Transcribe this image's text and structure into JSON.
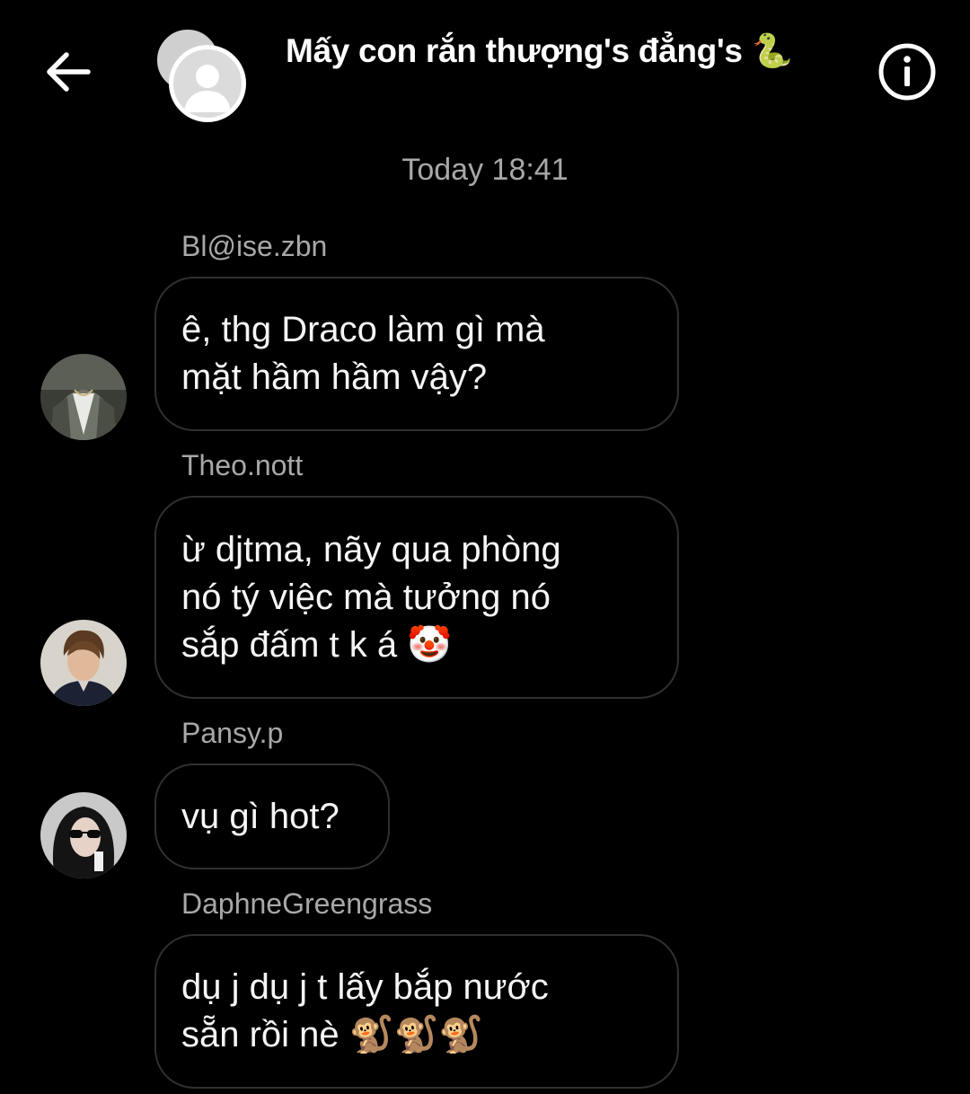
{
  "header": {
    "back_icon": "arrow-left-icon",
    "title": "Mấy con rắn thượng's đẳng's 🐍",
    "info_icon": "info-circle-icon"
  },
  "chat": {
    "timestamp": "Today 18:41",
    "messages": [
      {
        "sender": "Bl@ise.zbn",
        "lines": [
          "ê, thg Draco làm gì mà",
          "mặt hầm hầm vậy?"
        ]
      },
      {
        "sender": "Theo.nott",
        "lines": [
          "ừ djtma, nãy qua phòng",
          "nó tý việc mà tưởng nó",
          "sắp đấm t k á 🤡"
        ]
      },
      {
        "sender": "Pansy.p",
        "lines": [
          "vụ gì hot?"
        ]
      },
      {
        "sender": "DaphneGreengrass",
        "lines": [
          "dụ j dụ j t lấy bắp nước",
          "sẵn rồi nè 🐒🐒🐒"
        ]
      }
    ]
  },
  "colors": {
    "background": "#000000",
    "secondary_text": "#a8a8a8",
    "bubble_border": "#303030"
  }
}
